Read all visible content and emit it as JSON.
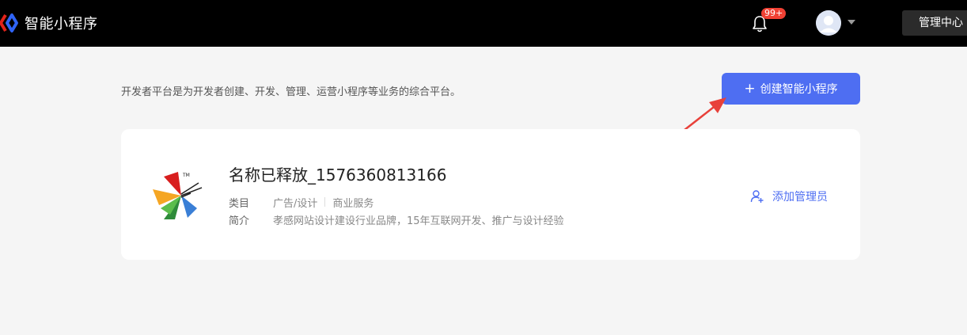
{
  "header": {
    "brand_title": "智能小程序",
    "notification_badge": "99+",
    "manage_center": "管理中心"
  },
  "main": {
    "intro_text": "开发者平台是为开发者创建、开发、管理、运营小程序等业务的综合平台。",
    "create_button": "创建智能小程序"
  },
  "app_card": {
    "name": "名称已释放_1576360813166",
    "category_label": "类目",
    "category_primary": "广告/设计",
    "category_secondary": "商业服务",
    "intro_label": "简介",
    "intro_value": "孝感网站设计建设行业品牌，15年互联网开发、推广与设计经验",
    "add_admin": "添加管理员"
  },
  "colors": {
    "accent": "#4e6ef2",
    "badge": "#f04134",
    "annotation_arrow": "#e8413a"
  }
}
